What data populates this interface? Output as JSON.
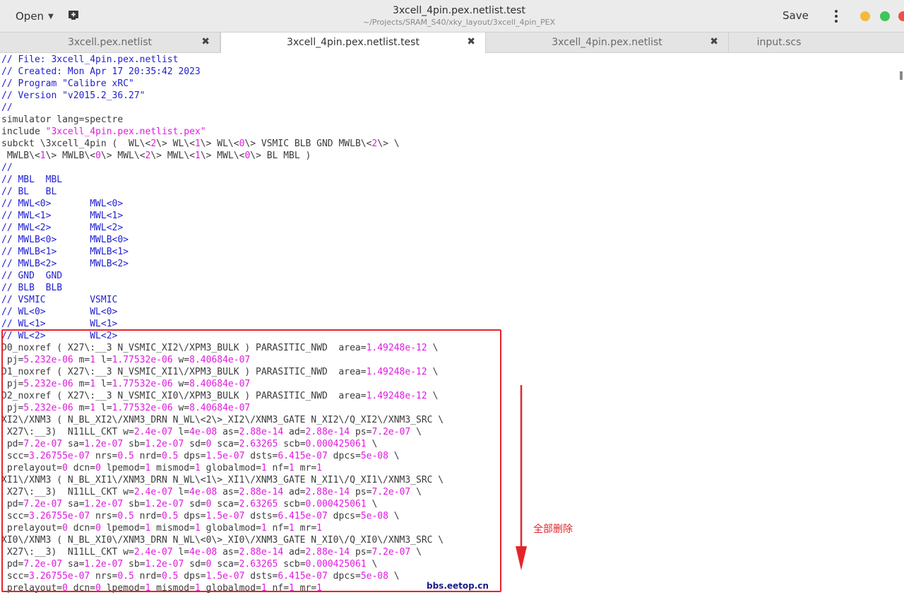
{
  "titlebar": {
    "open_label": "Open",
    "title": "3xcell_4pin.pex.netlist.test",
    "subtitle": "~/Projects/SRAM_S40/xky_layout/3xcell_4pin_PEX",
    "save_label": "Save",
    "window_dot_colors": [
      "#f6b93b",
      "#3fc55a",
      "#ee5045"
    ]
  },
  "tabs": [
    {
      "label": "3xcell.pex.netlist",
      "active": false
    },
    {
      "label": "3xcell_4pin.pex.netlist.test",
      "active": true
    },
    {
      "label": "3xcell_4pin.pex.netlist",
      "active": false
    },
    {
      "label": "input.scs",
      "active": false
    }
  ],
  "close_glyph": "✖",
  "code_lines": [
    [
      [
        "c",
        "// File: 3xcell_4pin.pex.netlist"
      ]
    ],
    [
      [
        "c",
        "// Created: Mon Apr 17 20:35:42 2023"
      ]
    ],
    [
      [
        "c",
        "// Program \"Calibre xRC\""
      ]
    ],
    [
      [
        "c",
        "// Version \"v2015.2_36.27\""
      ]
    ],
    [
      [
        "c",
        "//"
      ]
    ],
    [
      [
        "k",
        "simulator lang=spectre"
      ]
    ],
    [
      [
        "k",
        "include "
      ],
      [
        "s",
        "\"3xcell_4pin.pex.netlist.pex\""
      ]
    ],
    [
      [
        "k",
        "subckt \\3xcell_4pin (  WL\\<"
      ],
      [
        "n",
        "2"
      ],
      [
        "k",
        "\\> WL\\<"
      ],
      [
        "n",
        "1"
      ],
      [
        "k",
        "\\> WL\\<"
      ],
      [
        "n",
        "0"
      ],
      [
        "k",
        "\\> VSMIC BLB GND MWLB\\<"
      ],
      [
        "n",
        "2"
      ],
      [
        "k",
        "\\> \\"
      ]
    ],
    [
      [
        "k",
        " MWLB\\<"
      ],
      [
        "n",
        "1"
      ],
      [
        "k",
        "\\> MWLB\\<"
      ],
      [
        "n",
        "0"
      ],
      [
        "k",
        "\\> MWL\\<"
      ],
      [
        "n",
        "2"
      ],
      [
        "k",
        "\\> MWL\\<"
      ],
      [
        "n",
        "1"
      ],
      [
        "k",
        "\\> MWL\\<"
      ],
      [
        "n",
        "0"
      ],
      [
        "k",
        "\\> BL MBL )"
      ]
    ],
    [
      [
        "c",
        "//"
      ]
    ],
    [
      [
        "c",
        "// MBL  MBL"
      ]
    ],
    [
      [
        "c",
        "// BL   BL"
      ]
    ],
    [
      [
        "c",
        "// MWL<0>       MWL<0>"
      ]
    ],
    [
      [
        "c",
        "// MWL<1>       MWL<1>"
      ]
    ],
    [
      [
        "c",
        "// MWL<2>       MWL<2>"
      ]
    ],
    [
      [
        "c",
        "// MWLB<0>      MWLB<0>"
      ]
    ],
    [
      [
        "c",
        "// MWLB<1>      MWLB<1>"
      ]
    ],
    [
      [
        "c",
        "// MWLB<2>      MWLB<2>"
      ]
    ],
    [
      [
        "c",
        "// GND  GND"
      ]
    ],
    [
      [
        "c",
        "// BLB  BLB"
      ]
    ],
    [
      [
        "c",
        "// VSMIC        VSMIC"
      ]
    ],
    [
      [
        "c",
        "// WL<0>        WL<0>"
      ]
    ],
    [
      [
        "c",
        "// WL<1>        WL<1>"
      ]
    ],
    [
      [
        "c",
        "// WL<2>        WL<2>"
      ]
    ],
    [
      [
        "k",
        "D0_noxref ( X27\\:__3 N_VSMIC_XI2\\/XPM3_BULK ) PARASITIC_NWD  area="
      ],
      [
        "n",
        "1.49248e-12"
      ],
      [
        "k",
        " \\"
      ]
    ],
    [
      [
        "k",
        " pj="
      ],
      [
        "n",
        "5.232e-06"
      ],
      [
        "k",
        " m="
      ],
      [
        "n",
        "1"
      ],
      [
        "k",
        " l="
      ],
      [
        "n",
        "1.77532e-06"
      ],
      [
        "k",
        " w="
      ],
      [
        "n",
        "8.40684e-07"
      ]
    ],
    [
      [
        "k",
        "D1_noxref ( X27\\:__3 N_VSMIC_XI1\\/XPM3_BULK ) PARASITIC_NWD  area="
      ],
      [
        "n",
        "1.49248e-12"
      ],
      [
        "k",
        " \\"
      ]
    ],
    [
      [
        "k",
        " pj="
      ],
      [
        "n",
        "5.232e-06"
      ],
      [
        "k",
        " m="
      ],
      [
        "n",
        "1"
      ],
      [
        "k",
        " l="
      ],
      [
        "n",
        "1.77532e-06"
      ],
      [
        "k",
        " w="
      ],
      [
        "n",
        "8.40684e-07"
      ]
    ],
    [
      [
        "k",
        "D2_noxref ( X27\\:__3 N_VSMIC_XI0\\/XPM3_BULK ) PARASITIC_NWD  area="
      ],
      [
        "n",
        "1.49248e-12"
      ],
      [
        "k",
        " \\"
      ]
    ],
    [
      [
        "k",
        " pj="
      ],
      [
        "n",
        "5.232e-06"
      ],
      [
        "k",
        " m="
      ],
      [
        "n",
        "1"
      ],
      [
        "k",
        " l="
      ],
      [
        "n",
        "1.77532e-06"
      ],
      [
        "k",
        " w="
      ],
      [
        "n",
        "8.40684e-07"
      ]
    ],
    [
      [
        "k",
        "XI2\\/XNM3 ( N_BL_XI2\\/XNM3_DRN N_WL\\<2\\>_XI2\\/XNM3_GATE N_XI2\\/Q_XI2\\/XNM3_SRC \\"
      ]
    ],
    [
      [
        "k",
        " X27\\:__3)  N11LL_CKT w="
      ],
      [
        "n",
        "2.4e-07"
      ],
      [
        "k",
        " l="
      ],
      [
        "n",
        "4e-08"
      ],
      [
        "k",
        " as="
      ],
      [
        "n",
        "2.88e-14"
      ],
      [
        "k",
        " ad="
      ],
      [
        "n",
        "2.88e-14"
      ],
      [
        "k",
        " ps="
      ],
      [
        "n",
        "7.2e-07"
      ],
      [
        "k",
        " \\"
      ]
    ],
    [
      [
        "k",
        " pd="
      ],
      [
        "n",
        "7.2e-07"
      ],
      [
        "k",
        " sa="
      ],
      [
        "n",
        "1.2e-07"
      ],
      [
        "k",
        " sb="
      ],
      [
        "n",
        "1.2e-07"
      ],
      [
        "k",
        " sd="
      ],
      [
        "n",
        "0"
      ],
      [
        "k",
        " sca="
      ],
      [
        "n",
        "2.63265"
      ],
      [
        "k",
        " scb="
      ],
      [
        "n",
        "0.000425061"
      ],
      [
        "k",
        " \\"
      ]
    ],
    [
      [
        "k",
        " scc="
      ],
      [
        "n",
        "3.26755e-07"
      ],
      [
        "k",
        " nrs="
      ],
      [
        "n",
        "0.5"
      ],
      [
        "k",
        " nrd="
      ],
      [
        "n",
        "0.5"
      ],
      [
        "k",
        " dps="
      ],
      [
        "n",
        "1.5e-07"
      ],
      [
        "k",
        " dsts="
      ],
      [
        "n",
        "6.415e-07"
      ],
      [
        "k",
        " dpcs="
      ],
      [
        "n",
        "5e-08"
      ],
      [
        "k",
        " \\"
      ]
    ],
    [
      [
        "k",
        " prelayout="
      ],
      [
        "n",
        "0"
      ],
      [
        "k",
        " dcn="
      ],
      [
        "n",
        "0"
      ],
      [
        "k",
        " lpemod="
      ],
      [
        "n",
        "1"
      ],
      [
        "k",
        " mismod="
      ],
      [
        "n",
        "1"
      ],
      [
        "k",
        " globalmod="
      ],
      [
        "n",
        "1"
      ],
      [
        "k",
        " nf="
      ],
      [
        "n",
        "1"
      ],
      [
        "k",
        " mr="
      ],
      [
        "n",
        "1"
      ]
    ],
    [
      [
        "k",
        "XI1\\/XNM3 ( N_BL_XI1\\/XNM3_DRN N_WL\\<1\\>_XI1\\/XNM3_GATE N_XI1\\/Q_XI1\\/XNM3_SRC \\"
      ]
    ],
    [
      [
        "k",
        " X27\\:__3)  N11LL_CKT w="
      ],
      [
        "n",
        "2.4e-07"
      ],
      [
        "k",
        " l="
      ],
      [
        "n",
        "4e-08"
      ],
      [
        "k",
        " as="
      ],
      [
        "n",
        "2.88e-14"
      ],
      [
        "k",
        " ad="
      ],
      [
        "n",
        "2.88e-14"
      ],
      [
        "k",
        " ps="
      ],
      [
        "n",
        "7.2e-07"
      ],
      [
        "k",
        " \\"
      ]
    ],
    [
      [
        "k",
        " pd="
      ],
      [
        "n",
        "7.2e-07"
      ],
      [
        "k",
        " sa="
      ],
      [
        "n",
        "1.2e-07"
      ],
      [
        "k",
        " sb="
      ],
      [
        "n",
        "1.2e-07"
      ],
      [
        "k",
        " sd="
      ],
      [
        "n",
        "0"
      ],
      [
        "k",
        " sca="
      ],
      [
        "n",
        "2.63265"
      ],
      [
        "k",
        " scb="
      ],
      [
        "n",
        "0.000425061"
      ],
      [
        "k",
        " \\"
      ]
    ],
    [
      [
        "k",
        " scc="
      ],
      [
        "n",
        "3.26755e-07"
      ],
      [
        "k",
        " nrs="
      ],
      [
        "n",
        "0.5"
      ],
      [
        "k",
        " nrd="
      ],
      [
        "n",
        "0.5"
      ],
      [
        "k",
        " dps="
      ],
      [
        "n",
        "1.5e-07"
      ],
      [
        "k",
        " dsts="
      ],
      [
        "n",
        "6.415e-07"
      ],
      [
        "k",
        " dpcs="
      ],
      [
        "n",
        "5e-08"
      ],
      [
        "k",
        " \\"
      ]
    ],
    [
      [
        "k",
        " prelayout="
      ],
      [
        "n",
        "0"
      ],
      [
        "k",
        " dcn="
      ],
      [
        "n",
        "0"
      ],
      [
        "k",
        " lpemod="
      ],
      [
        "n",
        "1"
      ],
      [
        "k",
        " mismod="
      ],
      [
        "n",
        "1"
      ],
      [
        "k",
        " globalmod="
      ],
      [
        "n",
        "1"
      ],
      [
        "k",
        " nf="
      ],
      [
        "n",
        "1"
      ],
      [
        "k",
        " mr="
      ],
      [
        "n",
        "1"
      ]
    ],
    [
      [
        "k",
        "XI0\\/XNM3 ( N_BL_XI0\\/XNM3_DRN N_WL\\<0\\>_XI0\\/XNM3_GATE N_XI0\\/Q_XI0\\/XNM3_SRC \\"
      ]
    ],
    [
      [
        "k",
        " X27\\:__3)  N11LL_CKT w="
      ],
      [
        "n",
        "2.4e-07"
      ],
      [
        "k",
        " l="
      ],
      [
        "n",
        "4e-08"
      ],
      [
        "k",
        " as="
      ],
      [
        "n",
        "2.88e-14"
      ],
      [
        "k",
        " ad="
      ],
      [
        "n",
        "2.88e-14"
      ],
      [
        "k",
        " ps="
      ],
      [
        "n",
        "7.2e-07"
      ],
      [
        "k",
        " \\"
      ]
    ],
    [
      [
        "k",
        " pd="
      ],
      [
        "n",
        "7.2e-07"
      ],
      [
        "k",
        " sa="
      ],
      [
        "n",
        "1.2e-07"
      ],
      [
        "k",
        " sb="
      ],
      [
        "n",
        "1.2e-07"
      ],
      [
        "k",
        " sd="
      ],
      [
        "n",
        "0"
      ],
      [
        "k",
        " sca="
      ],
      [
        "n",
        "2.63265"
      ],
      [
        "k",
        " scb="
      ],
      [
        "n",
        "0.000425061"
      ],
      [
        "k",
        " \\"
      ]
    ],
    [
      [
        "k",
        " scc="
      ],
      [
        "n",
        "3.26755e-07"
      ],
      [
        "k",
        " nrs="
      ],
      [
        "n",
        "0.5"
      ],
      [
        "k",
        " nrd="
      ],
      [
        "n",
        "0.5"
      ],
      [
        "k",
        " dps="
      ],
      [
        "n",
        "1.5e-07"
      ],
      [
        "k",
        " dsts="
      ],
      [
        "n",
        "6.415e-07"
      ],
      [
        "k",
        " dpcs="
      ],
      [
        "n",
        "5e-08"
      ],
      [
        "k",
        " \\"
      ]
    ],
    [
      [
        "k",
        " prelayout="
      ],
      [
        "n",
        "0"
      ],
      [
        "k",
        " dcn="
      ],
      [
        "n",
        "0"
      ],
      [
        "k",
        " lpemod="
      ],
      [
        "n",
        "1"
      ],
      [
        "k",
        " mismod="
      ],
      [
        "n",
        "1"
      ],
      [
        "k",
        " globalmod="
      ],
      [
        "n",
        "1"
      ],
      [
        "k",
        " nf="
      ],
      [
        "n",
        "1"
      ],
      [
        "k",
        " mr="
      ],
      [
        "n",
        "1"
      ]
    ]
  ],
  "annotation": {
    "note": "全部删除",
    "watermark": "bbs.eetop.cn",
    "color": "#e5242a"
  }
}
